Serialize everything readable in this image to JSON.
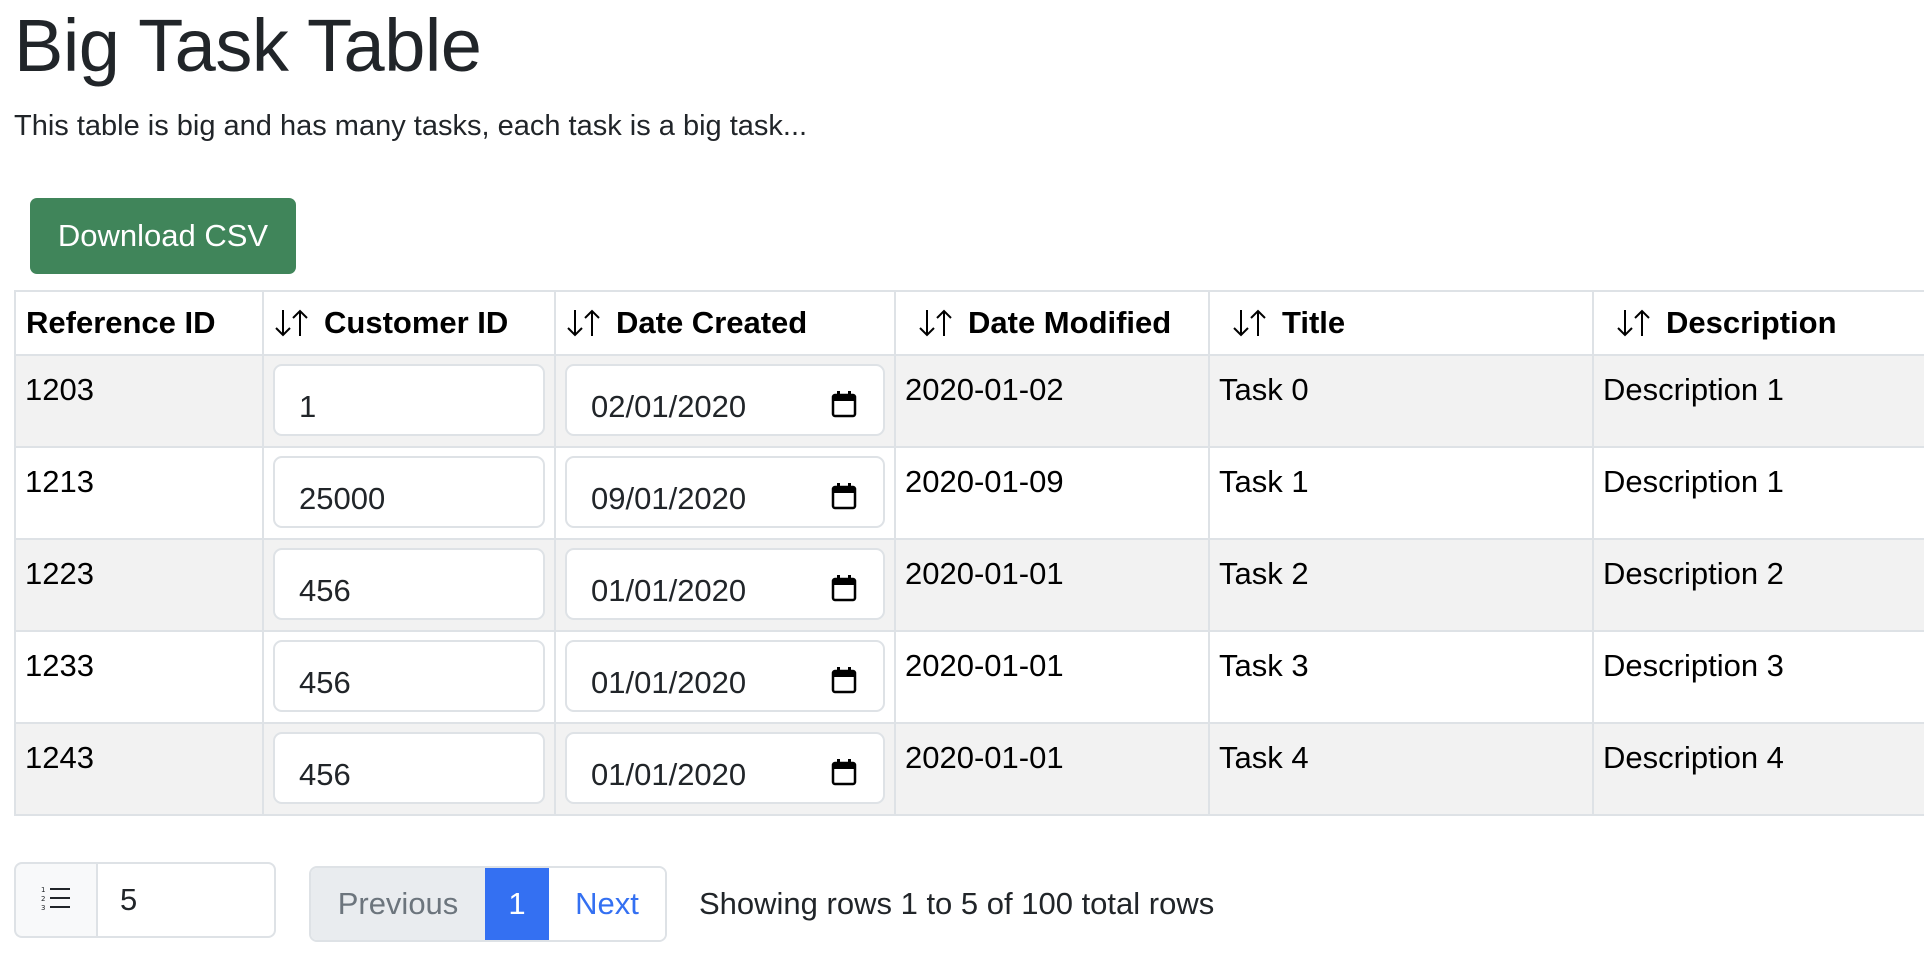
{
  "header": {
    "title": "Big Task Table",
    "subtitle": "This table is big and has many tasks, each task is a big task..."
  },
  "toolbar": {
    "download_label": "Download CSV",
    "download_color": "#40855a"
  },
  "table": {
    "columns": [
      {
        "label": "Reference ID",
        "sortable": false
      },
      {
        "label": "Customer ID",
        "sortable": true,
        "icon": "sort-arrows-icon"
      },
      {
        "label": "Date Created",
        "sortable": true,
        "icon": "sort-arrows-icon"
      },
      {
        "label": "Date Modified",
        "sortable": true,
        "icon": "sort-arrows-icon"
      },
      {
        "label": "Title",
        "sortable": true,
        "icon": "sort-arrows-icon"
      },
      {
        "label": "Description",
        "sortable": true,
        "icon": "sort-arrows-icon"
      }
    ],
    "rows": [
      {
        "reference_id": "1203",
        "customer_id": "1",
        "date_created": "02/01/2020",
        "date_modified": "2020-01-02",
        "title": "Task 0",
        "description": "Description 1"
      },
      {
        "reference_id": "1213",
        "customer_id": "25000",
        "date_created": "09/01/2020",
        "date_modified": "2020-01-09",
        "title": "Task 1",
        "description": "Description 1"
      },
      {
        "reference_id": "1223",
        "customer_id": "456",
        "date_created": "01/01/2020",
        "date_modified": "2020-01-01",
        "title": "Task 2",
        "description": "Description 2"
      },
      {
        "reference_id": "1233",
        "customer_id": "456",
        "date_created": "01/01/2020",
        "date_modified": "2020-01-01",
        "title": "Task 3",
        "description": "Description 3"
      },
      {
        "reference_id": "1243",
        "customer_id": "456",
        "date_created": "01/01/2020",
        "date_modified": "2020-01-01",
        "title": "Task 4",
        "description": "Description 4"
      }
    ],
    "stripe_color": "#f2f2f2",
    "border_color": "#dee2e6"
  },
  "pagination": {
    "rows_per_page_icon": "numbered-list-icon",
    "rows_per_page": "5",
    "previous_label": "Previous",
    "current_page": "1",
    "next_label": "Next",
    "active_color": "#3470f2",
    "summary": "Showing rows 1 to 5 of 100 total rows"
  }
}
